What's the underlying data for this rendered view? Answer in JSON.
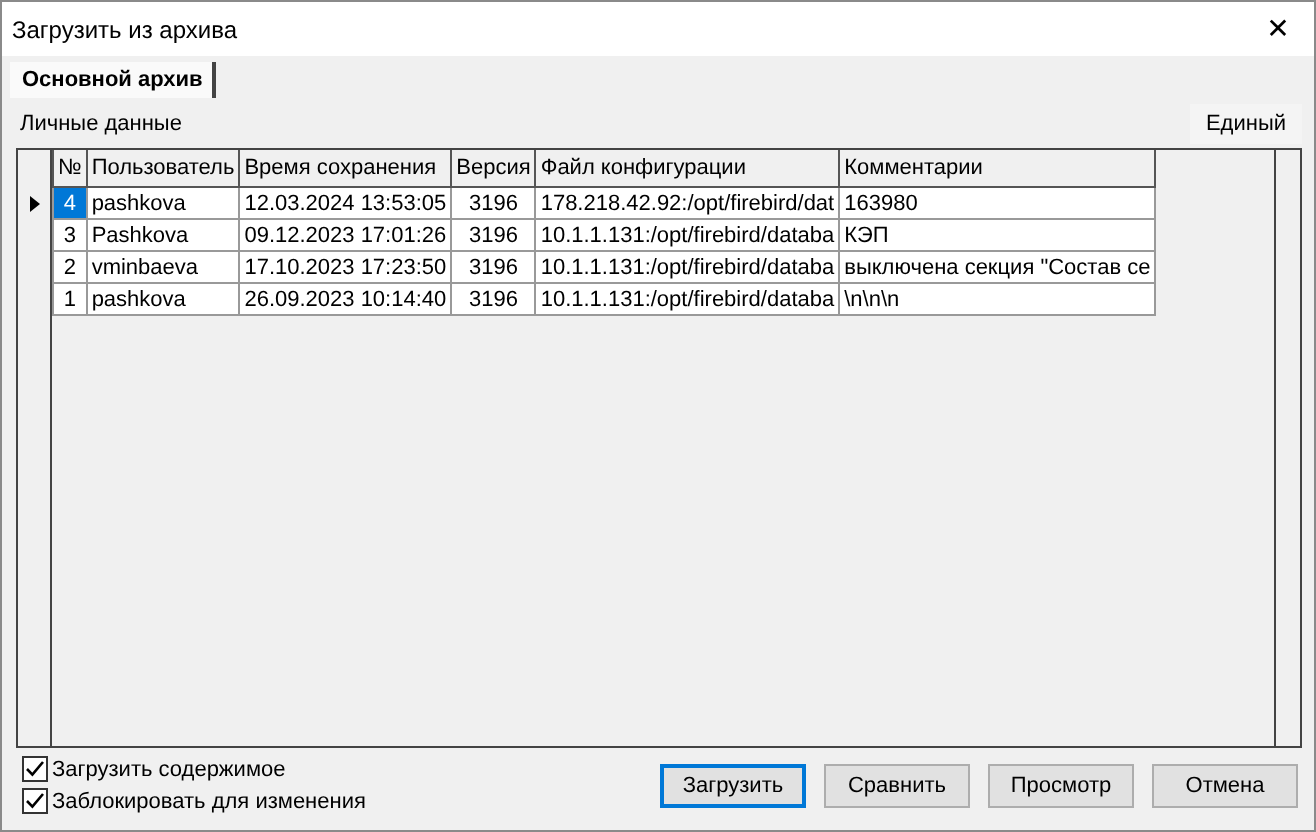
{
  "window": {
    "title": "Загрузить из архива",
    "close": "✕"
  },
  "tabs": [
    {
      "label": "Основной архив",
      "selected": true
    }
  ],
  "section_label": "Личные данные",
  "mode_button": "Единый",
  "table": {
    "columns": [
      "№",
      "Пользователь",
      "Время сохранения",
      "Версия",
      "Файл конфигурации",
      "Комментарии"
    ],
    "rows": [
      {
        "cells": [
          "4",
          "pashkova",
          "12.03.2024 13:53:05",
          "3196",
          "178.218.42.92:/opt/firebird/dat",
          "163980"
        ],
        "selected": true
      },
      {
        "cells": [
          "3",
          "Pashkova",
          "09.12.2023 17:01:26",
          "3196",
          "10.1.1.131:/opt/firebird/databa",
          "КЭП"
        ],
        "selected": false
      },
      {
        "cells": [
          "2",
          "vminbaeva",
          "17.10.2023 17:23:50",
          "3196",
          "10.1.1.131:/opt/firebird/databa",
          "выключена секция \"Состав се"
        ],
        "selected": false
      },
      {
        "cells": [
          "1",
          "pashkova",
          "26.09.2023 10:14:40",
          "3196",
          "10.1.1.131:/opt/firebird/databa",
          "\\n\\n\\n"
        ],
        "selected": false
      }
    ]
  },
  "options": [
    {
      "label": "Загрузить содержимое",
      "checked": true
    },
    {
      "label": "Заблокировать для изменения",
      "checked": true
    }
  ],
  "buttons": [
    {
      "label": "Загрузить",
      "default": true
    },
    {
      "label": "Сравнить",
      "default": false
    },
    {
      "label": "Просмотр",
      "default": false
    },
    {
      "label": "Отмена",
      "default": false
    }
  ]
}
